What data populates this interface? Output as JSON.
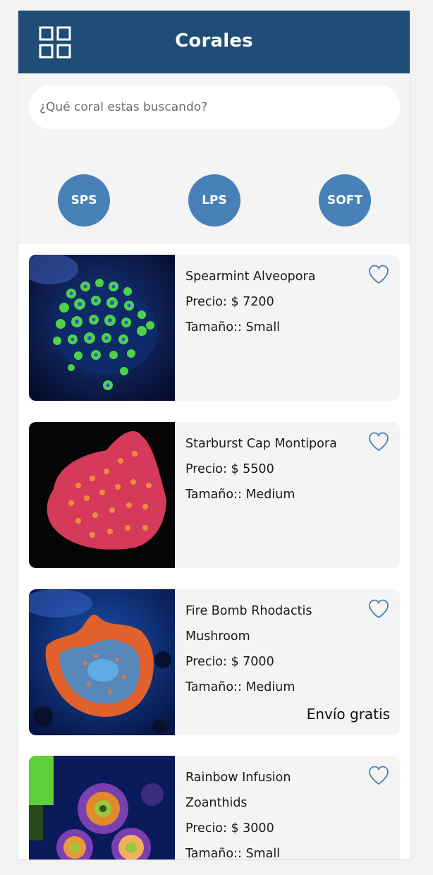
{
  "header": {
    "title": "Corales",
    "menu_icon": "grid-icon"
  },
  "search": {
    "placeholder": "¿Qué coral estas buscando?"
  },
  "categories": [
    {
      "label": "SPS"
    },
    {
      "label": "LPS"
    },
    {
      "label": "SOFT"
    }
  ],
  "colors": {
    "header": "#1f4d75",
    "accent": "#4781b8",
    "card_bg": "#f4f4f4"
  },
  "products": [
    {
      "name": "Spearmint Alveopora",
      "price": "Precio: $ 7200",
      "size": "Tamaño:: Small",
      "shipping": ""
    },
    {
      "name": "Starburst Cap Montipora",
      "price": "Precio: $ 5500",
      "size": "Tamaño:: Medium",
      "shipping": ""
    },
    {
      "name_line1": "Fire Bomb Rhodactis",
      "name_line2": "Mushroom",
      "price": "Precio: $ 7000",
      "size": "Tamaño:: Medium",
      "shipping": "Envío gratis"
    },
    {
      "name_line1": "Rainbow Infusion",
      "name_line2": "Zoanthids",
      "price": "Precio: $ 3000",
      "size": "Tamaño:: Small",
      "shipping": ""
    }
  ]
}
